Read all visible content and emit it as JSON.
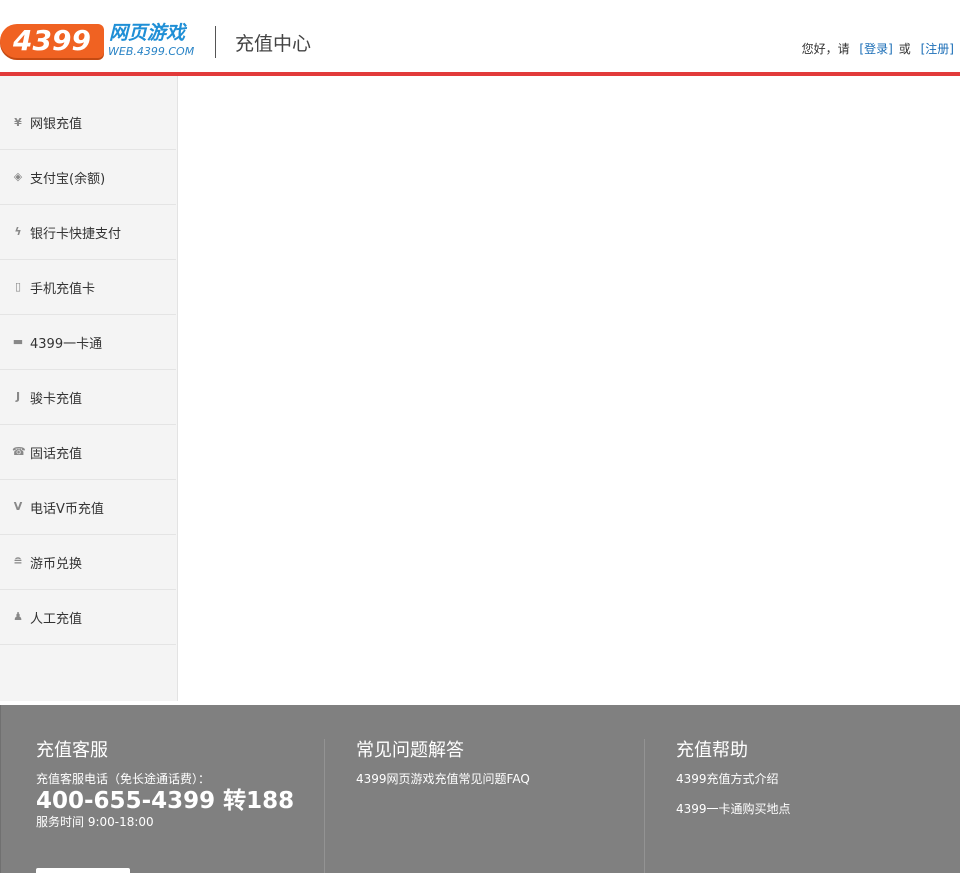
{
  "header": {
    "logo_number": "4399",
    "logo_cn": "网页游戏",
    "logo_en": "WEB.4399.COM",
    "page_title": "充值中心",
    "greeting": "您好，请",
    "login_link": "[登录]",
    "or_text": "或",
    "register_link": "[注册]"
  },
  "sidebar": {
    "items": [
      {
        "icon": "yen-icon",
        "glyph": "¥",
        "label": "网银充值"
      },
      {
        "icon": "shield-icon",
        "glyph": "◈",
        "label": "支付宝(余额)"
      },
      {
        "icon": "lightning-icon",
        "glyph": "ϟ",
        "label": "银行卡快捷支付"
      },
      {
        "icon": "mobile-phone-icon",
        "glyph": "▯",
        "label": "手机充值卡"
      },
      {
        "icon": "card-icon",
        "glyph": "▬",
        "label": "4399一卡通"
      },
      {
        "icon": "j-card-icon",
        "glyph": "J",
        "label": "骏卡充值"
      },
      {
        "icon": "telephone-icon",
        "glyph": "☎",
        "label": "固话充值"
      },
      {
        "icon": "v-coin-icon",
        "glyph": "V",
        "label": "电话V币充值"
      },
      {
        "icon": "coins-icon",
        "glyph": "≘",
        "label": "游币兑换"
      },
      {
        "icon": "person-icon",
        "glyph": "♟",
        "label": "人工充值"
      }
    ]
  },
  "footer": {
    "service": {
      "title": "充值客服",
      "phone_label": "充值客服电话（免长途通话费）：",
      "phone": "400-655-4399 转188",
      "hours": "服务时间 9:00-18:00"
    },
    "faq": {
      "title": "常见问题解答",
      "links": [
        "4399网页游戏充值常见问题FAQ"
      ]
    },
    "help": {
      "title": "充值帮助",
      "links": [
        "4399充值方式介绍",
        "4399一卡通购买地点"
      ]
    }
  },
  "colors": {
    "accent_red": "#e23a3a",
    "logo_orange": "#f06222",
    "link_blue": "#1b6eb7",
    "footer_gray": "#808080"
  }
}
